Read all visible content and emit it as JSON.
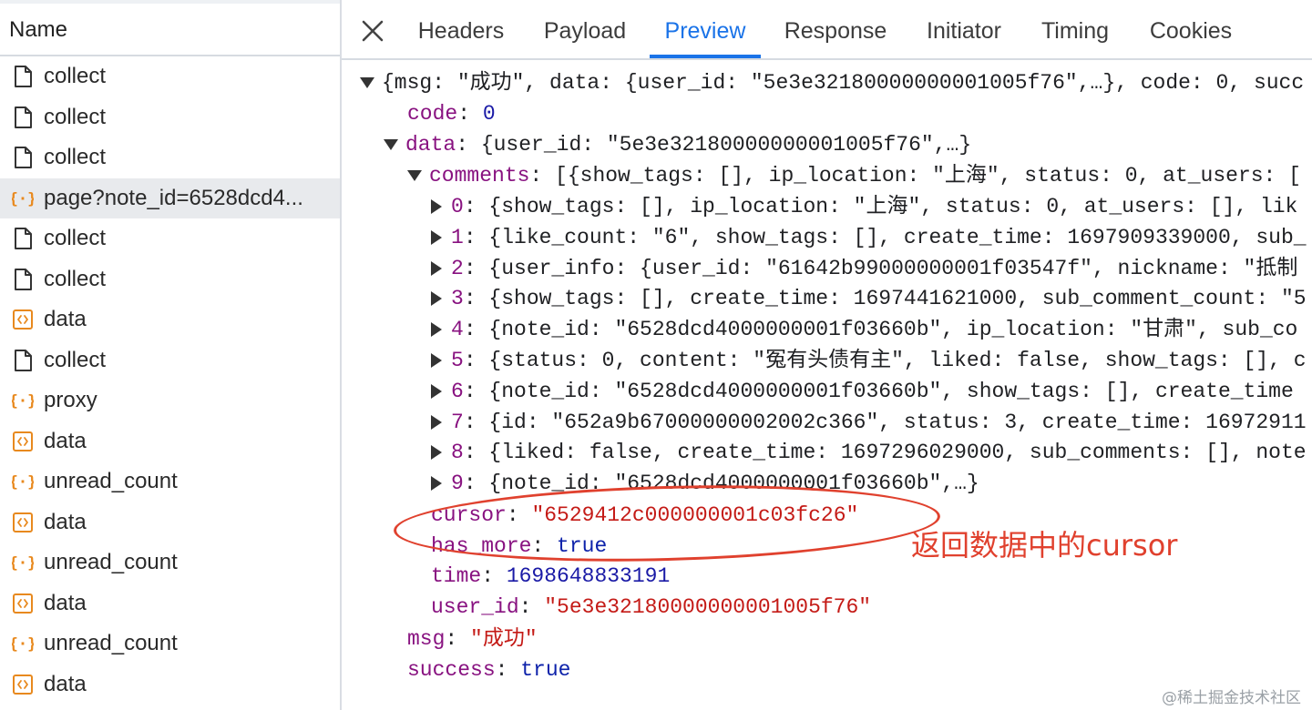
{
  "request_list": {
    "header": "Name",
    "rows": [
      {
        "name": "collect",
        "icon": "document-icon"
      },
      {
        "name": "collect",
        "icon": "document-icon"
      },
      {
        "name": "collect",
        "icon": "document-icon"
      },
      {
        "name": "page?note_id=6528dcd4...",
        "icon": "json-icon",
        "selected": true
      },
      {
        "name": "collect",
        "icon": "document-icon"
      },
      {
        "name": "collect",
        "icon": "document-icon"
      },
      {
        "name": "data",
        "icon": "code-icon"
      },
      {
        "name": "collect",
        "icon": "document-icon"
      },
      {
        "name": "proxy",
        "icon": "json-icon"
      },
      {
        "name": "data",
        "icon": "code-icon"
      },
      {
        "name": "unread_count",
        "icon": "json-icon"
      },
      {
        "name": "data",
        "icon": "code-icon"
      },
      {
        "name": "unread_count",
        "icon": "json-icon"
      },
      {
        "name": "data",
        "icon": "code-icon"
      },
      {
        "name": "unread_count",
        "icon": "json-icon"
      },
      {
        "name": "data",
        "icon": "code-icon"
      }
    ]
  },
  "tabs": [
    {
      "label": "Headers"
    },
    {
      "label": "Payload"
    },
    {
      "label": "Preview",
      "active": true
    },
    {
      "label": "Response"
    },
    {
      "label": "Initiator"
    },
    {
      "label": "Timing"
    },
    {
      "label": "Cookies"
    }
  ],
  "preview": {
    "root_summary": "{msg: \"成功\", data: {user_id: \"5e3e32180000000001005f76\",…}, code: 0, succ",
    "code": {
      "key": "code",
      "value": "0"
    },
    "data_summary": {
      "key": "data",
      "value": "{user_id: \"5e3e32180000000001005f76\",…}"
    },
    "comments_summary": {
      "key": "comments",
      "value": "[{show_tags: [], ip_location: \"上海\", status: 0, at_users: ["
    },
    "comments": [
      {
        "index": "0",
        "value": "{show_tags: [], ip_location: \"上海\", status: 0, at_users: [], lik"
      },
      {
        "index": "1",
        "value": "{like_count: \"6\", show_tags: [], create_time: 1697909339000, sub_"
      },
      {
        "index": "2",
        "value": "{user_info: {user_id: \"61642b99000000001f03547f\", nickname: \"抵制"
      },
      {
        "index": "3",
        "value": "{show_tags: [], create_time: 1697441621000, sub_comment_count: \"5"
      },
      {
        "index": "4",
        "value": "{note_id: \"6528dcd4000000001f03660b\", ip_location: \"甘肃\", sub_co"
      },
      {
        "index": "5",
        "value": "{status: 0, content: \"冤有头债有主\", liked: false, show_tags: [], c"
      },
      {
        "index": "6",
        "value": "{note_id: \"6528dcd4000000001f03660b\", show_tags: [], create_time"
      },
      {
        "index": "7",
        "value": "{id: \"652a9b67000000002002c366\", status: 3, create_time: 16972911"
      },
      {
        "index": "8",
        "value": "{liked: false, create_time: 1697296029000, sub_comments: [], note"
      },
      {
        "index": "9",
        "value": "{note_id: \"6528dcd4000000001f03660b\",…}"
      }
    ],
    "cursor": {
      "key": "cursor",
      "value": "\"6529412c000000001c03fc26\""
    },
    "has_more": {
      "key": "has_more",
      "value": "true"
    },
    "time": {
      "key": "time",
      "value": "1698648833191"
    },
    "user_id": {
      "key": "user_id",
      "value": "\"5e3e32180000000001005f76\""
    },
    "msg": {
      "key": "msg",
      "value": "\"成功\""
    },
    "success": {
      "key": "success",
      "value": "true"
    }
  },
  "annotation": {
    "text": "返回数据中的cursor",
    "color": "#e0412e"
  },
  "watermark": "@稀土掘金技术社区",
  "colors": {
    "accent": "#1a73e8",
    "key": "#881280",
    "string": "#c41a16",
    "number": "#1a1aa6",
    "icon_orange": "#e8891e"
  }
}
